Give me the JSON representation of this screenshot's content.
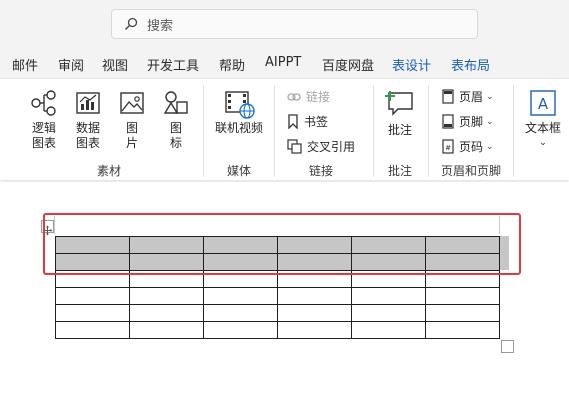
{
  "search": {
    "placeholder": "搜索"
  },
  "tabs": [
    {
      "label": "邮件"
    },
    {
      "label": "审阅"
    },
    {
      "label": "视图"
    },
    {
      "label": "开发工具"
    },
    {
      "label": "帮助"
    },
    {
      "label": "AIPPT"
    },
    {
      "label": "百度网盘"
    },
    {
      "label": "表设计"
    },
    {
      "label": "表布局"
    }
  ],
  "ribbon": {
    "groups": {
      "sucai": {
        "label": "素材",
        "buttons": [
          {
            "line1": "逻辑",
            "line2": "图表",
            "icon": "logic-chart-icon"
          },
          {
            "line1": "数据",
            "line2": "图表",
            "icon": "data-chart-icon"
          },
          {
            "line1": "图",
            "line2": "片",
            "icon": "picture-icon"
          },
          {
            "line1": "图",
            "line2": "标",
            "icon": "shapes-icon"
          }
        ]
      },
      "meiti": {
        "label": "媒体",
        "buttons": [
          {
            "line1": "联机视频",
            "icon": "online-video-icon"
          }
        ]
      },
      "lianjie": {
        "label": "链接",
        "items": [
          {
            "label": "链接",
            "icon": "link-icon",
            "disabled": true
          },
          {
            "label": "书签",
            "icon": "bookmark-icon"
          },
          {
            "label": "交叉引用",
            "icon": "cross-reference-icon"
          }
        ]
      },
      "pizhu": {
        "label": "批注",
        "buttons": [
          {
            "line1": "批注",
            "icon": "comment-icon"
          }
        ]
      },
      "yemei": {
        "label": "页眉和页脚",
        "items": [
          {
            "label": "页眉",
            "icon": "header-icon"
          },
          {
            "label": "页脚",
            "icon": "footer-icon"
          },
          {
            "label": "页码",
            "icon": "page-number-icon"
          }
        ]
      },
      "wenben": {
        "buttons": [
          {
            "line1": "文本框",
            "icon": "textbox-icon"
          }
        ]
      }
    }
  },
  "document": {
    "table": {
      "rows": 6,
      "cols": 6,
      "selected_rows": [
        0,
        1
      ]
    }
  },
  "colors": {
    "accent": "#1a5fb4",
    "highlight": "#e0393e",
    "selection": "#c6c6c6"
  }
}
